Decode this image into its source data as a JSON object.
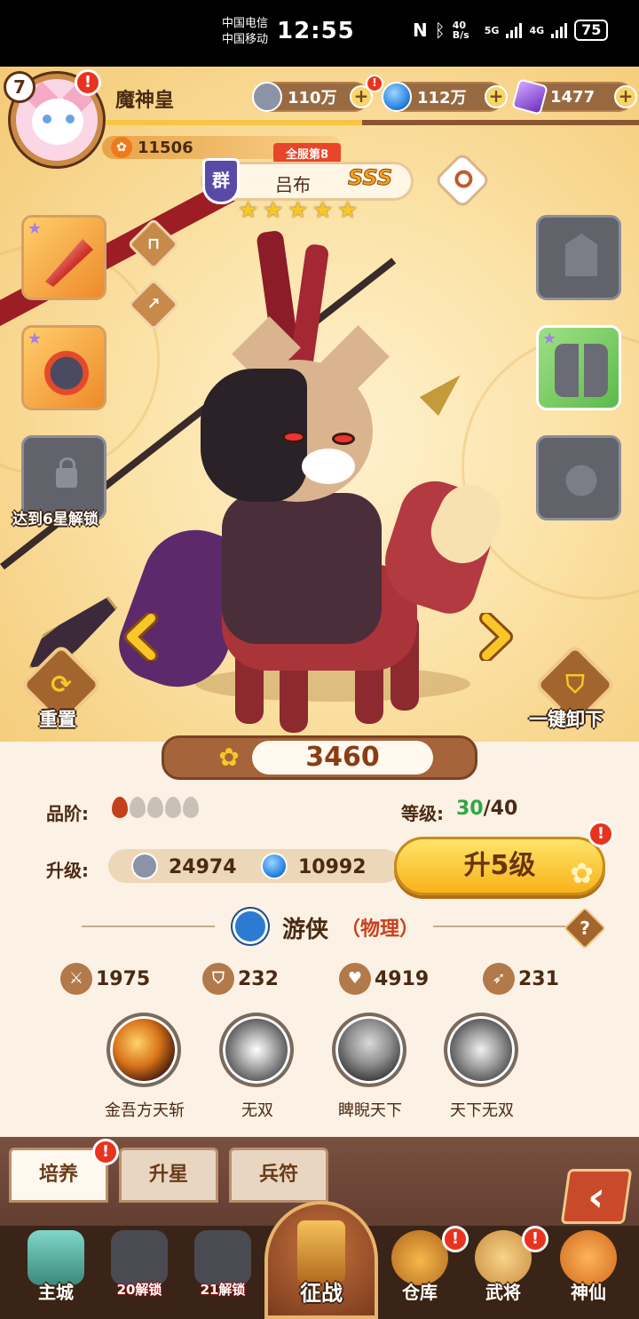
{
  "status_bar": {
    "carrier_1": "中国电信",
    "carrier_2": "中国移动",
    "time": "12:55",
    "net_speed": "40 B/s",
    "net_1": "5G",
    "net_2": "4G",
    "battery": "75"
  },
  "player": {
    "level": "7",
    "name": "魔神皇",
    "paw_points": "11506",
    "alert": "!"
  },
  "currencies": [
    {
      "name": "coin",
      "value": "110万",
      "color": "#8a94a6"
    },
    {
      "name": "orb",
      "value": "112万",
      "color": "#2f8ae3"
    },
    {
      "name": "crystal",
      "value": "1477",
      "color": "#8a4fd6"
    }
  ],
  "hero": {
    "rank": "全服第8",
    "faction": "群",
    "name": "吕布",
    "grade": "SSS",
    "stars": 5,
    "power": "3460"
  },
  "equipment": {
    "unlock_hint": "达到6星解锁"
  },
  "actions": {
    "reset": "重置",
    "unequip_all": "一键卸下"
  },
  "stats_panel": {
    "quality_label": "品阶:",
    "quality_level": 1,
    "quality_max": 5,
    "level_label": "等级:",
    "level_current": "30",
    "level_max": "/40",
    "upgrade_label": "升级:",
    "cost_coin": "24974",
    "cost_orb": "10992",
    "upgrade_button": "升5级",
    "class_name": "游侠",
    "class_type": "（物理）",
    "help": "?",
    "attack": "1975",
    "defense": "232",
    "hp": "4919",
    "speed": "231"
  },
  "skills": [
    {
      "name": "金吾方天斩",
      "color": "#d9731a"
    },
    {
      "name": "无双",
      "color": "#b9b9b9"
    },
    {
      "name": "睥睨天下",
      "color": "#8f8f8f"
    },
    {
      "name": "天下无双",
      "color": "#a5a5a5"
    }
  ],
  "tabs": [
    {
      "label": "培养",
      "active": true
    },
    {
      "label": "升星",
      "active": false
    },
    {
      "label": "兵符",
      "active": false
    }
  ],
  "nav": {
    "main_city": "主城",
    "locked_1": "20解锁",
    "locked_2": "21解锁",
    "battle": "征战",
    "warehouse": "仓库",
    "generals": "武将",
    "immortals": "神仙"
  }
}
